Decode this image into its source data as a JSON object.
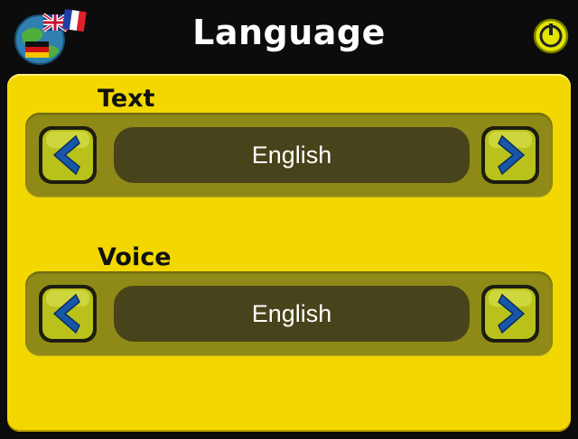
{
  "header": {
    "title": "Language",
    "logo_icon": "globe-flags-icon",
    "power_icon": "power-icon"
  },
  "sections": [
    {
      "label": "Text",
      "value": "English",
      "prev_icon": "chevron-left-icon",
      "next_icon": "chevron-right-icon"
    },
    {
      "label": "Voice",
      "value": "English",
      "prev_icon": "chevron-left-icon",
      "next_icon": "chevron-right-icon"
    }
  ],
  "colors": {
    "background": "#0c0c0c",
    "panel": "#f2d800",
    "selector_track": "#8f8a17",
    "value_box": "#47431a",
    "arrow_button": "#b9c21a",
    "arrow_glyph": "#1856a8",
    "power_button": "#e2e600"
  }
}
